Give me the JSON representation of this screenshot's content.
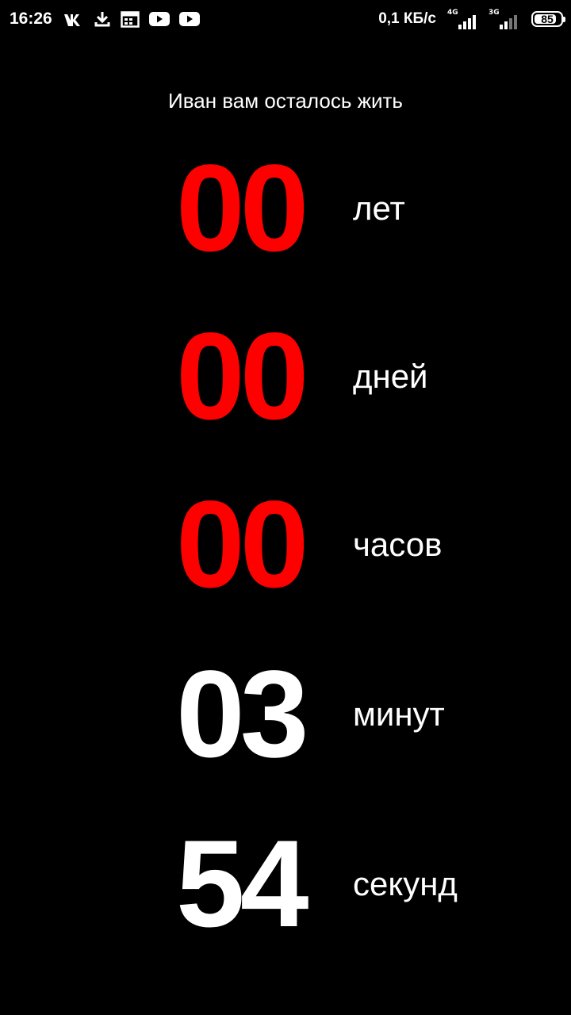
{
  "status_bar": {
    "time": "16:26",
    "network_speed": "0,1 КБ/с",
    "sim1_type": "4G",
    "sim2_type": "3G",
    "battery_level": "85",
    "battery_fraction": 0.85,
    "left_icons": [
      "vk-icon",
      "download-icon",
      "calendar-icon",
      "youtube-icon",
      "youtube-icon"
    ]
  },
  "heading": "Иван вам осталось жить",
  "colors": {
    "background": "#000000",
    "expired_value": "#ff0000",
    "active_value": "#ffffff",
    "text": "#ffffff"
  },
  "countdown": [
    {
      "value": "00",
      "unit": "лет",
      "color": "#ff0000"
    },
    {
      "value": "00",
      "unit": "дней",
      "color": "#ff0000"
    },
    {
      "value": "00",
      "unit": "часов",
      "color": "#ff0000"
    },
    {
      "value": "03",
      "unit": "минут",
      "color": "#ffffff"
    },
    {
      "value": "54",
      "unit": "секунд",
      "color": "#ffffff"
    }
  ]
}
